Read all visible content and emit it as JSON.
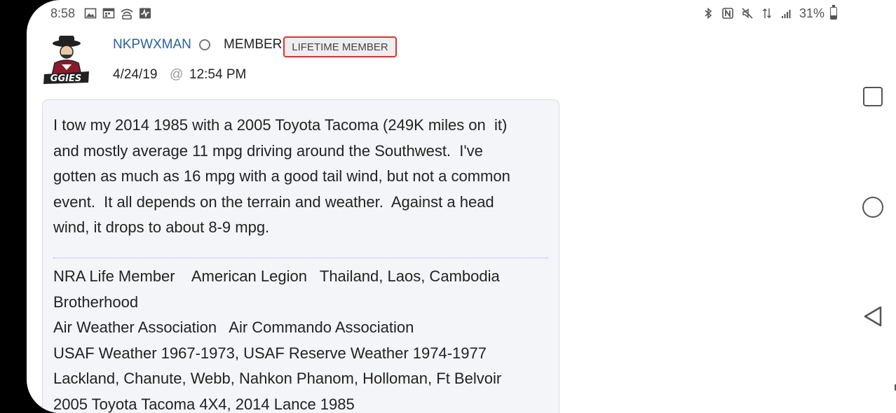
{
  "status_bar": {
    "time": "8:58",
    "battery": "31%",
    "battery_level": 0.31,
    "left_icons": [
      "image-icon",
      "calendar-icon",
      "wifi-hotspot-icon",
      "activity-icon"
    ],
    "right_icons": [
      "bluetooth-icon",
      "nfc-icon",
      "mute-icon",
      "data-arrows-icon",
      "signal-icon",
      "battery-icon"
    ]
  },
  "post": {
    "username": "NKPWXMAN",
    "role": "MEMBER",
    "badge": "LIFETIME MEMBER",
    "date": "4/24/19",
    "at": "@",
    "time": "12:54 PM",
    "body": "I tow my 2014 1985 with a 2005 Toyota Tacoma (249K miles on  it)\nand mostly average 11 mpg driving around the Southwest.  I've\ngotten as much as 16 mpg with a good tail wind, but not a common\nevent.  It all depends on the terrain and weather.  Against a head\nwind, it drops to about 8-9 mpg.",
    "signature": [
      "NRA Life Member    American Legion   Thailand, Laos, Cambodia",
      "Brotherhood",
      "Air Weather Association   Air Commando Association",
      "USAF Weather 1967-1973, USAF Reserve Weather 1974-1977",
      "Lackland, Chanute, Webb, Nahkon Phanom, Holloman, Ft Belvoir",
      "2005 Toyota Tacoma 4X4, 2014 Lance 1985"
    ]
  },
  "colors": {
    "username": "#2b5f9e",
    "badge_border": "#dd3333",
    "message_bg": "#f4f5f9"
  }
}
